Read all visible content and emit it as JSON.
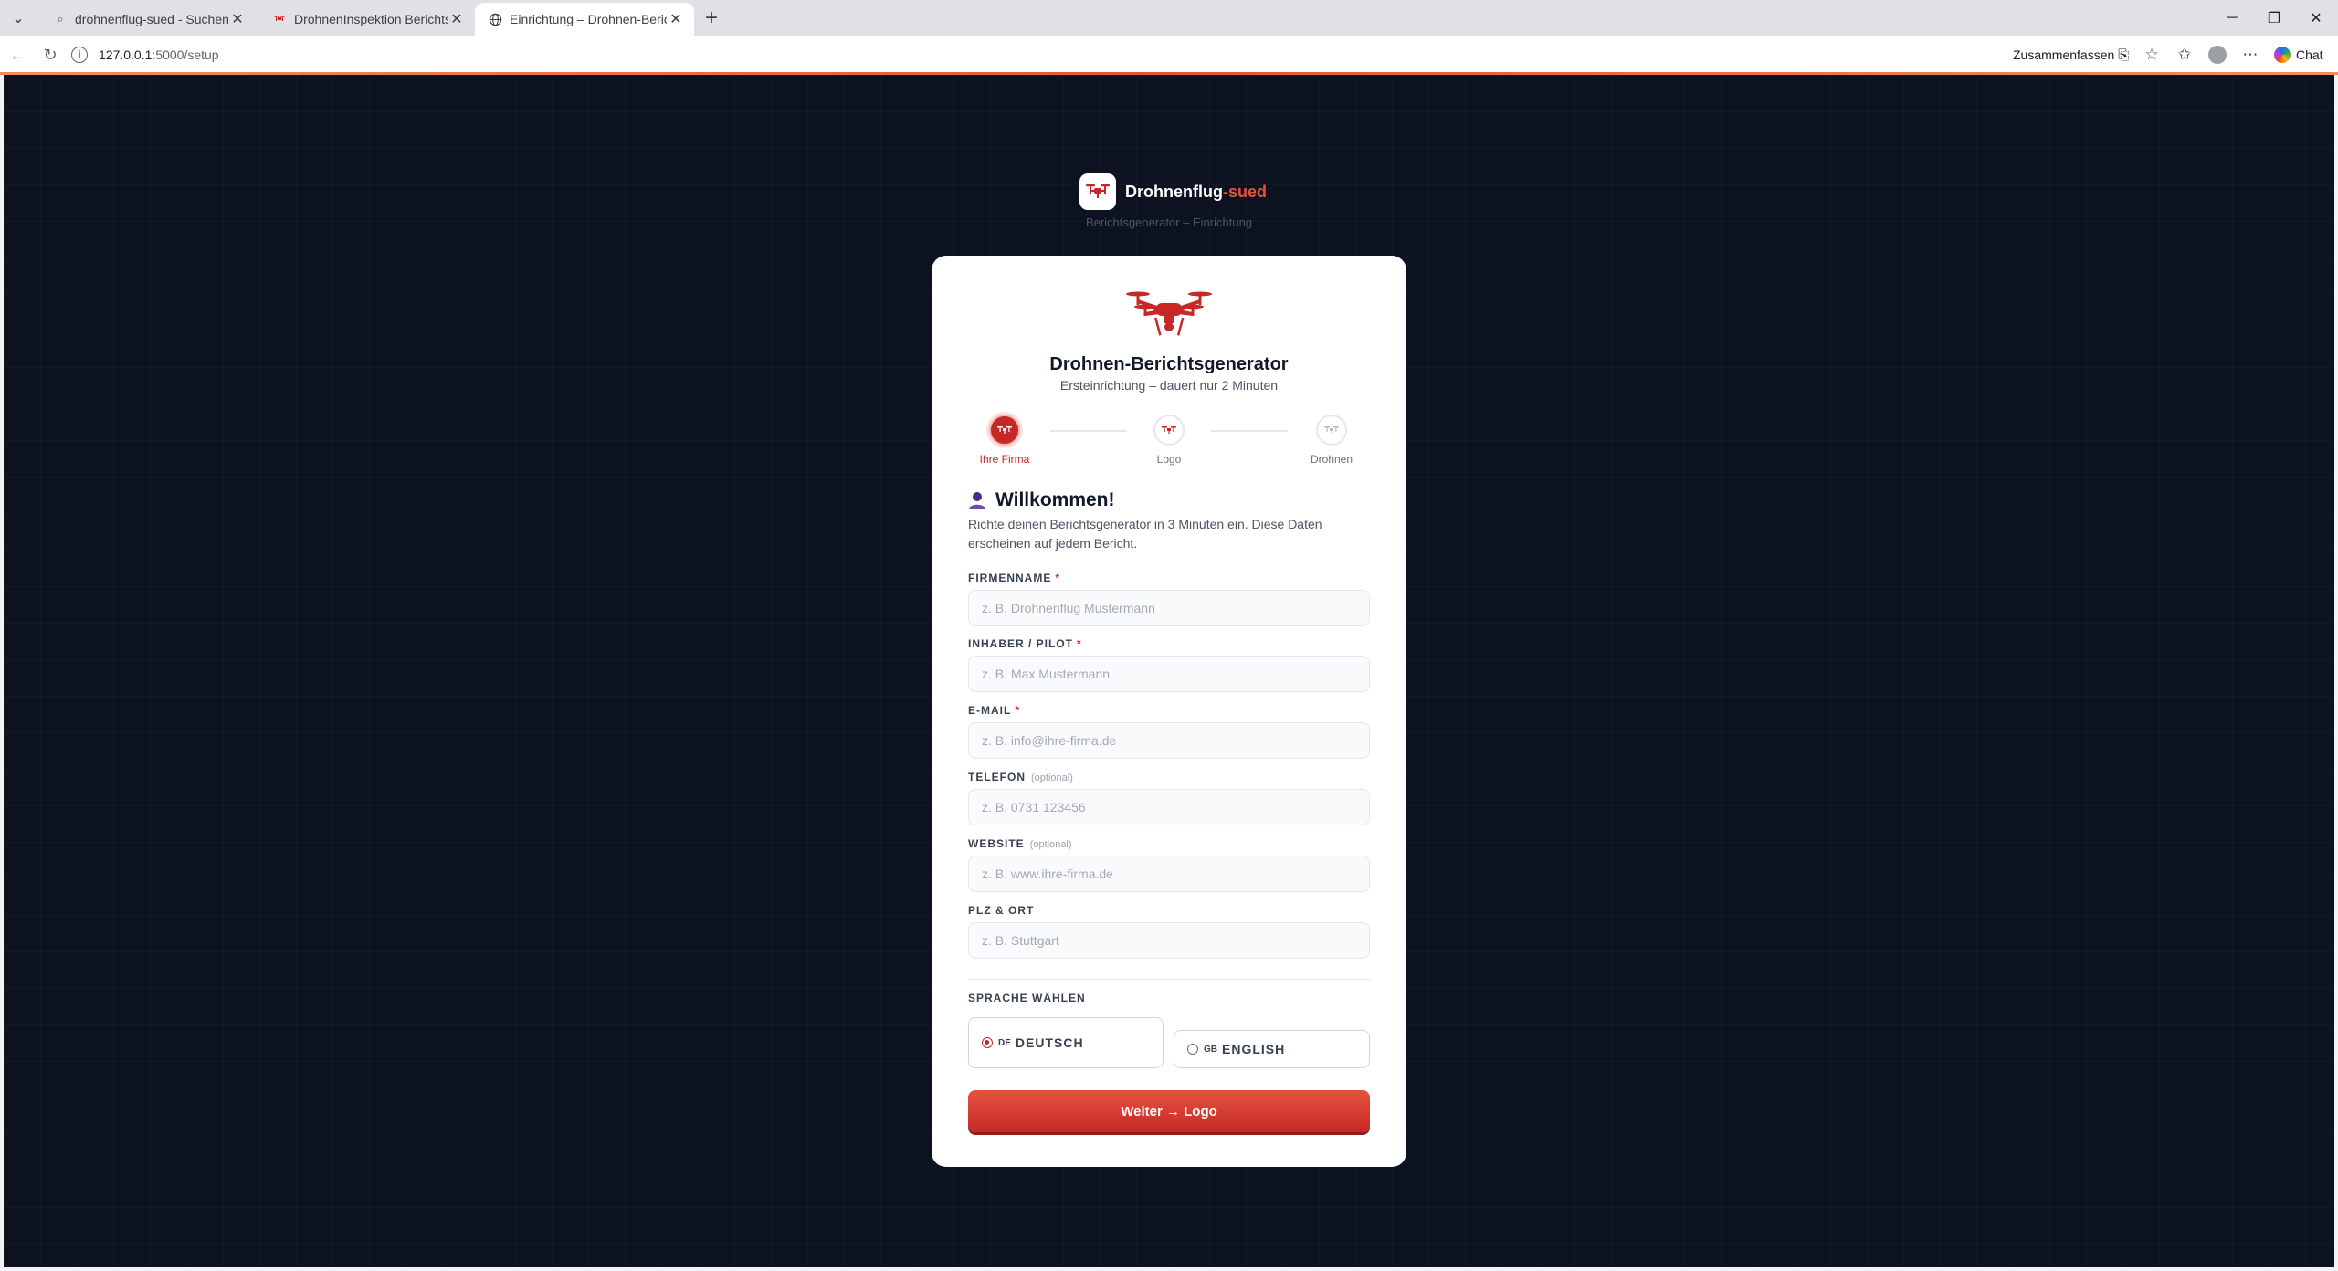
{
  "browser": {
    "tabs": [
      {
        "title": "drohnenflug-sued - Suchen",
        "icon": "search-icon"
      },
      {
        "title": "DrohnenInspektion Berichts Gene",
        "icon": "drone-favicon-icon"
      },
      {
        "title": "Einrichtung – Drohnen-Berichtsge",
        "icon": "globe-icon"
      }
    ],
    "active_tab": 2,
    "url_host": "127.0.0.1",
    "url_path": ":5000/setup",
    "summarize_label": "Zusammenfassen",
    "chat_label": "Chat"
  },
  "brand": {
    "name": "Drohnenflug",
    "name_accent": "-sued",
    "subtitle": "Berichtsgenerator – Einrichtung",
    "accent_color": "#e5533d"
  },
  "card": {
    "title": "Drohnen-Berichtsgenerator",
    "subtitle": "Ersteinrichtung – dauert nur 2 Minuten",
    "steps": [
      {
        "label": "Ihre Firma",
        "active": true
      },
      {
        "label": "Logo",
        "active": false
      },
      {
        "label": "Drohnen",
        "active": false
      }
    ],
    "welcome": "Willkommen!",
    "intro": "Richte deinen Berichtsgenerator in 3 Minuten ein. Diese Daten erscheinen auf jedem Bericht."
  },
  "form": {
    "company": {
      "label": "FIRMENNAME",
      "required": "*",
      "placeholder": "z. B. Drohnenflug Mustermann",
      "value": ""
    },
    "owner": {
      "label": "INHABER / PILOT",
      "required": "*",
      "placeholder": "z. B. Max Mustermann",
      "value": ""
    },
    "email": {
      "label": "E-MAIL",
      "required": "*",
      "placeholder": "z. B. info@ihre-firma.de",
      "value": ""
    },
    "phone": {
      "label": "TELEFON",
      "optional": "(optional)",
      "placeholder": "z. B. 0731 123456",
      "value": ""
    },
    "website": {
      "label": "WEBSITE",
      "optional": "(optional)",
      "placeholder": "z. B. www.ihre-firma.de",
      "value": ""
    },
    "city": {
      "label": "PLZ & ORT",
      "placeholder": "z. B. Stuttgart",
      "value": ""
    },
    "language": {
      "label": "SPRACHE WÄHLEN",
      "options": [
        {
          "flag": "DE",
          "label": "DEUTSCH",
          "selected": true
        },
        {
          "flag": "GB",
          "label": "ENGLISH",
          "selected": false
        }
      ]
    },
    "submit_label": "Weiter → Logo"
  }
}
